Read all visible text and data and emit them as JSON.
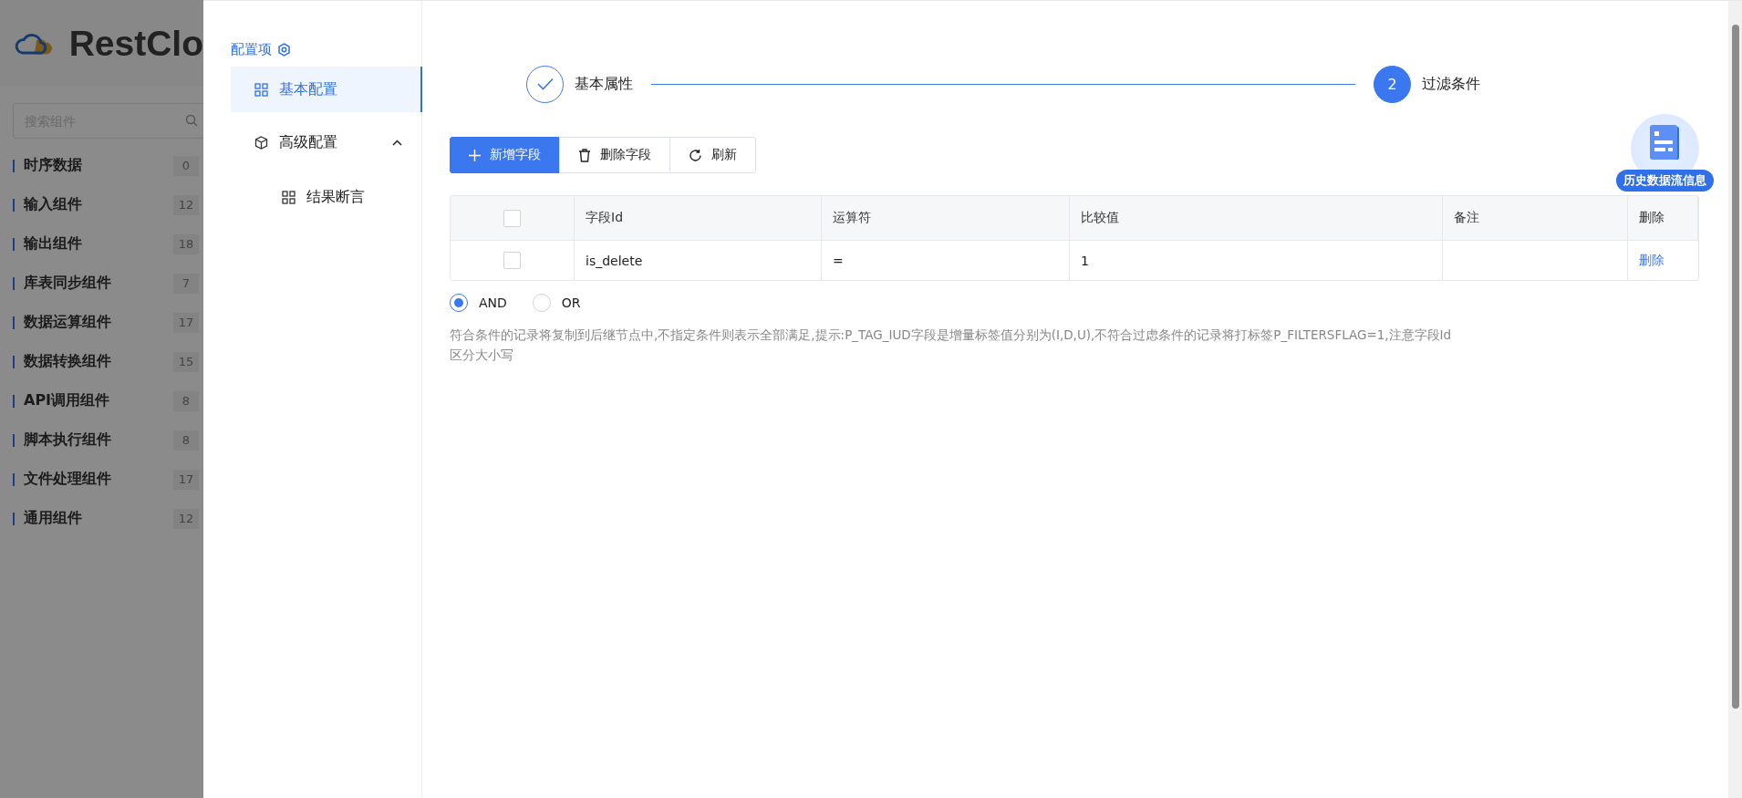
{
  "app": {
    "logo_text": "RestClo",
    "search": {
      "placeholder": "搜索组件"
    },
    "categories": [
      {
        "label": "时序数据",
        "count": "0"
      },
      {
        "label": "输入组件",
        "count": "12"
      },
      {
        "label": "输出组件",
        "count": "18"
      },
      {
        "label": "库表同步组件",
        "count": "7"
      },
      {
        "label": "数据运算组件",
        "count": "17"
      },
      {
        "label": "数据转换组件",
        "count": "15"
      },
      {
        "label": "API调用组件",
        "count": "8"
      },
      {
        "label": "脚本执行组件",
        "count": "8"
      },
      {
        "label": "文件处理组件",
        "count": "17"
      },
      {
        "label": "通用组件",
        "count": "12"
      }
    ]
  },
  "config_nav": {
    "title": "配置项",
    "items": [
      {
        "label": "基本配置",
        "selected": true
      },
      {
        "label": "高级配置",
        "selected": false,
        "expanded": true,
        "children": [
          {
            "label": "结果断言",
            "selected": false
          }
        ]
      }
    ]
  },
  "steps": [
    {
      "label": "基本属性",
      "done": true
    },
    {
      "label": "过滤条件",
      "done": false,
      "number": "2"
    }
  ],
  "toolbar": [
    {
      "label": "新增字段",
      "kind": "add",
      "primary": true
    },
    {
      "label": "删除字段",
      "kind": "delete",
      "primary": false
    },
    {
      "label": "刷新",
      "kind": "refresh",
      "primary": false
    }
  ],
  "table": {
    "columns": [
      "字段Id",
      "运算符",
      "比较值",
      "备注",
      "删除"
    ],
    "rows": [
      {
        "checked": false,
        "cells": [
          "is_delete",
          "=",
          "1",
          ""
        ],
        "action": "删除"
      }
    ],
    "header_checked": false
  },
  "logic": [
    {
      "label": "AND",
      "selected": true
    },
    {
      "label": "OR",
      "selected": false
    }
  ],
  "help_text": "符合条件的记录将复制到后继节点中,不指定条件则表示全部满足,提示:P_TAG_IUD字段是增量标签值分别为(I,D,U),不符合过虑条件的记录将打标签P_FILTERSFLAG=1,注意字段Id区分大小写",
  "float_badge": {
    "label": "历史数据流信息"
  }
}
